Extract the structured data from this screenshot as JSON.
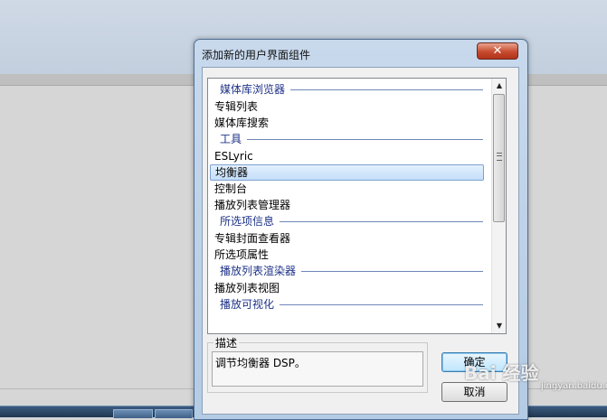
{
  "dialog": {
    "title": "添加新的用户界面组件",
    "close_icon": "close-icon",
    "close_glyph": "✕"
  },
  "list": {
    "groups": [
      {
        "label": "媒体库浏览器",
        "items": [
          "专辑列表",
          "媒体库搜索"
        ]
      },
      {
        "label": "工具",
        "items": [
          "ESLyric",
          "均衡器",
          "控制台",
          "播放列表管理器"
        ]
      },
      {
        "label": "所选项信息",
        "items": [
          "专辑封面查看器",
          "所选项属性"
        ]
      },
      {
        "label": "播放列表渲染器",
        "items": [
          "播放列表视图"
        ]
      },
      {
        "label": "播放可视化",
        "items": []
      }
    ],
    "selected": "均衡器"
  },
  "scrollbar": {
    "up_icon": "▲",
    "down_icon": "▼"
  },
  "description": {
    "title": "描述",
    "text": "调节均衡器 DSP。"
  },
  "buttons": {
    "ok_label": "确定",
    "cancel_label": "取消"
  },
  "watermark": {
    "text": "Bai 经验",
    "sub": "jingyan.baidu.com"
  }
}
